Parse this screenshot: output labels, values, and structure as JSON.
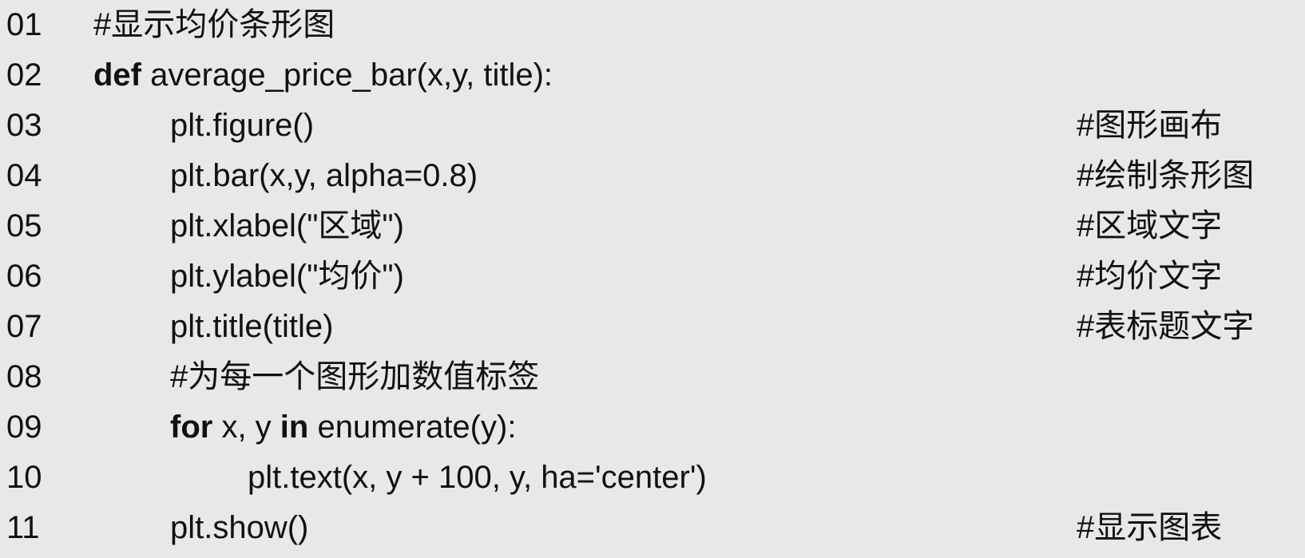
{
  "code_lines": [
    {
      "number": "01",
      "pre": "",
      "keyword": "",
      "mid": "",
      "keyword2": "",
      "text": "#显示均价条形图",
      "comment": ""
    },
    {
      "number": "02",
      "pre": "",
      "keyword": "def",
      "mid": "",
      "keyword2": "",
      "text": " average_price_bar(x,y, title):",
      "comment": ""
    },
    {
      "number": "03",
      "pre": "",
      "keyword": "",
      "mid": "",
      "keyword2": "",
      "text": "plt.figure()",
      "comment": "#图形画布"
    },
    {
      "number": "04",
      "pre": "",
      "keyword": "",
      "mid": "",
      "keyword2": "",
      "text": "plt.bar(x,y, alpha=0.8)",
      "comment": "#绘制条形图"
    },
    {
      "number": "05",
      "pre": "",
      "keyword": "",
      "mid": "",
      "keyword2": "",
      "text": "plt.xlabel(\"区域\")",
      "comment": "#区域文字"
    },
    {
      "number": "06",
      "pre": "",
      "keyword": "",
      "mid": "",
      "keyword2": "",
      "text": "plt.ylabel(\"均价\")",
      "comment": "#均价文字"
    },
    {
      "number": "07",
      "pre": "",
      "keyword": "",
      "mid": "",
      "keyword2": "",
      "text": "plt.title(title)",
      "comment": "#表标题文字"
    },
    {
      "number": "08",
      "pre": "",
      "keyword": "",
      "mid": "",
      "keyword2": "",
      "text": "#为每一个图形加数值标签",
      "comment": ""
    },
    {
      "number": "09",
      "pre": "",
      "keyword": "for",
      "mid": " x, y ",
      "keyword2": "in",
      "text": " enumerate(y):",
      "comment": ""
    },
    {
      "number": "10",
      "pre": "",
      "keyword": "",
      "mid": "",
      "keyword2": "",
      "text": "plt.text(x, y + 100, y, ha='center')",
      "comment": ""
    },
    {
      "number": "11",
      "pre": "",
      "keyword": "",
      "mid": "",
      "keyword2": "",
      "text": "plt.show()",
      "comment": "#显示图表"
    }
  ]
}
